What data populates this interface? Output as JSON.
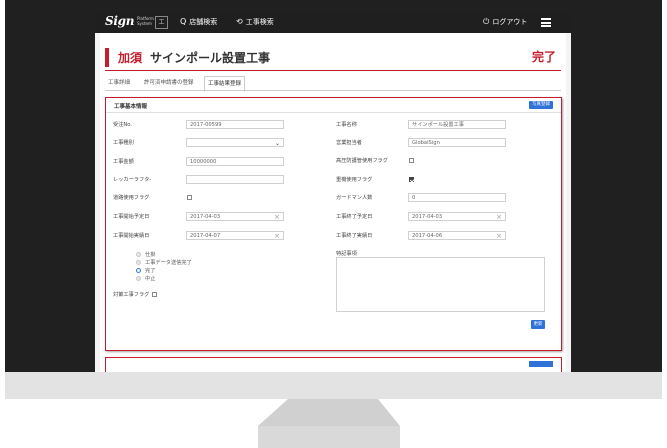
{
  "header": {
    "logo": "Sign",
    "logo_sub_1": "Platform",
    "logo_sub_2": "System",
    "logo_box": "工",
    "nav": [
      {
        "icon": "search-icon",
        "glyph": "Q",
        "label": "店舗検索"
      },
      {
        "icon": "history-icon",
        "glyph": "⟲",
        "label": "工事検索"
      },
      {
        "icon": "power-icon",
        "glyph": "⏻",
        "label": "ログアウト"
      }
    ],
    "menu_icon": "hamburger-menu-icon"
  },
  "page": {
    "title_keyword": "加須",
    "title": "サインポール設置工事",
    "status": "完了",
    "accent_color": "#c41e2e"
  },
  "tabs": [
    {
      "label": "工事詳細",
      "active": false
    },
    {
      "label": "許可済申請書の登録",
      "active": false
    },
    {
      "label": "工事結果登録",
      "active": true
    }
  ],
  "panel": {
    "title": "工事基本情報",
    "photo_button": "写真登録",
    "left_fields": {
      "order_no": {
        "label": "受注No.",
        "value": "2017-00599"
      },
      "work_type": {
        "label": "工事種別",
        "value": ""
      },
      "amount": {
        "label": "工事金額",
        "value": "10000000"
      },
      "wrecker": {
        "label": "レッカーラフタ-",
        "value": ""
      },
      "road_use": {
        "label": "道路使用フラグ",
        "checked": false
      },
      "start_plan": {
        "label": "工事開始予定日",
        "value": "2017-04-03"
      },
      "start_actual": {
        "label": "工事開始実績日",
        "value": "2017-04-07"
      }
    },
    "right_fields": {
      "work_name": {
        "label": "工事名称",
        "value": "サインポール設置工事"
      },
      "sales_rep": {
        "label": "営業担当者",
        "value": "GlobalSign"
      },
      "hv_guard": {
        "label": "高圧防護管使用フラグ",
        "checked": false
      },
      "heavy_vehicle": {
        "label": "重機使用フラグ",
        "checked": true
      },
      "guardman": {
        "label": "ガードマン人数",
        "value": "0"
      },
      "end_plan": {
        "label": "工事終了予定日",
        "value": "2017-04-03"
      },
      "end_actual": {
        "label": "工事終了実績日",
        "value": "2017-04-06"
      },
      "notes": {
        "label": "特記事項",
        "value": ""
      }
    },
    "status_options": [
      {
        "label": "仕掛",
        "selected": false
      },
      {
        "label": "工事データ送信完了",
        "selected": false
      },
      {
        "label": "完了",
        "selected": true
      },
      {
        "label": "中止",
        "selected": false
      }
    ],
    "countermeasure": {
      "label": "対策工事フラグ",
      "checked": false
    },
    "update_button": "更新"
  }
}
